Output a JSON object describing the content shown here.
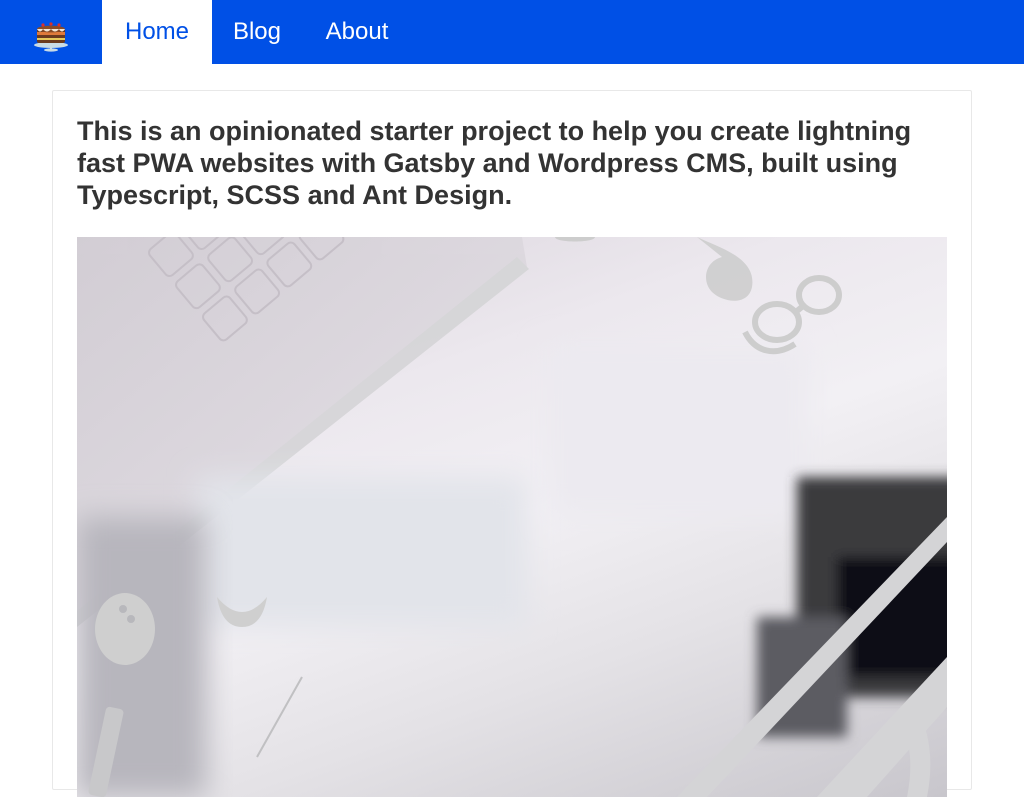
{
  "header": {
    "logo_icon": "cake-icon",
    "nav": [
      {
        "label": "Home",
        "active": true
      },
      {
        "label": "Blog",
        "active": false
      },
      {
        "label": "About",
        "active": false
      }
    ],
    "colors": {
      "primary": "#0050e6",
      "active_bg": "#ffffff"
    }
  },
  "main": {
    "intro": "This is an opinionated starter project to help you create lightning fast PWA websites with Gatsby and Wordpress CMS, built using Typescript, SCSS and Ant Design.",
    "hero_image": "desk-workspace-image"
  }
}
